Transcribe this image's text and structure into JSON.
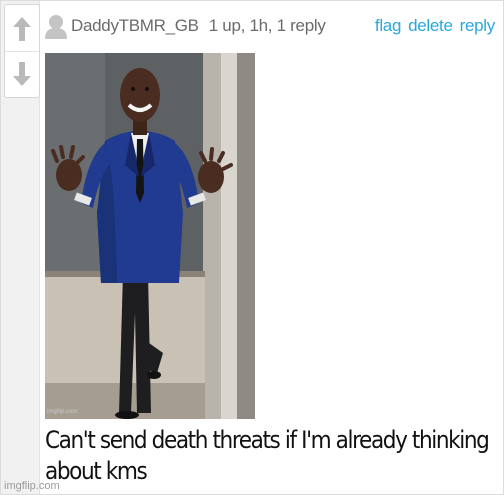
{
  "vote": {
    "up_icon": "arrow-up-icon",
    "down_icon": "arrow-down-icon"
  },
  "comment": {
    "username": "DaddyTBMR_GB",
    "meta": "1 up, 1h, 1 reply",
    "actions": [
      "flag",
      "delete",
      "reply"
    ],
    "text": "Can't send death threats if I'm already thinking about kms"
  },
  "meme_image": {
    "watermark": "imgflip.com"
  },
  "site_watermark": "imgflip.com",
  "colors": {
    "link": "#2aa8d8",
    "meta": "#6b6b6b",
    "vote_panel": "#f1f1f1"
  }
}
